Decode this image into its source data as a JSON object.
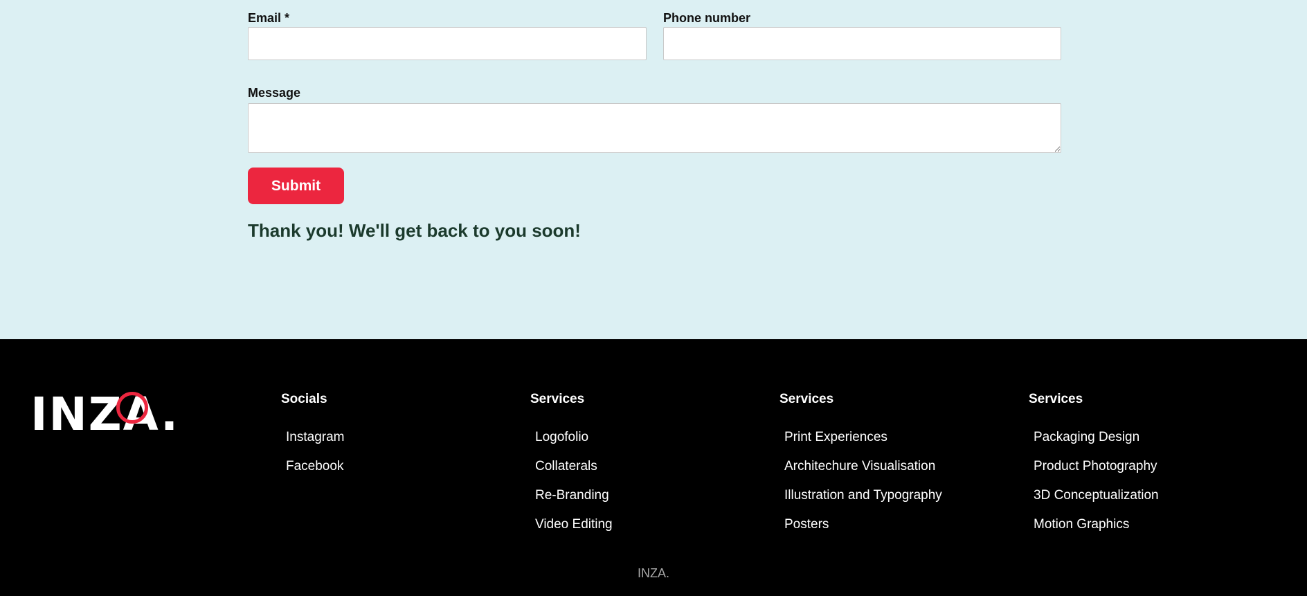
{
  "form": {
    "email_label": "Email *",
    "phone_label": "Phone number",
    "message_label": "Message",
    "submit_label": "Submit",
    "success_message": "Thank you! We'll get back to you soon!"
  },
  "footer": {
    "logo_alt": "INZA.",
    "logo_text": "INZA.",
    "columns": [
      {
        "heading": "Socials",
        "items": [
          "Instagram",
          "Facebook"
        ]
      },
      {
        "heading": "Services",
        "items": [
          "Logofolio",
          "Collaterals",
          "Re-Branding",
          "Video Editing"
        ]
      },
      {
        "heading": "Services",
        "items": [
          "Print Experiences",
          "Architechure Visualisation",
          "Illustration and Typography",
          "Posters"
        ]
      },
      {
        "heading": "Services",
        "items": [
          "Packaging Design",
          "Product Photography",
          "3D Conceptualization",
          "Motion Graphics"
        ]
      }
    ],
    "copyright": "INZA."
  },
  "colors": {
    "form_background": "#dcf0f3",
    "accent": "#ec263f",
    "success_text": "#1b3a2c",
    "footer_background": "#000000"
  }
}
